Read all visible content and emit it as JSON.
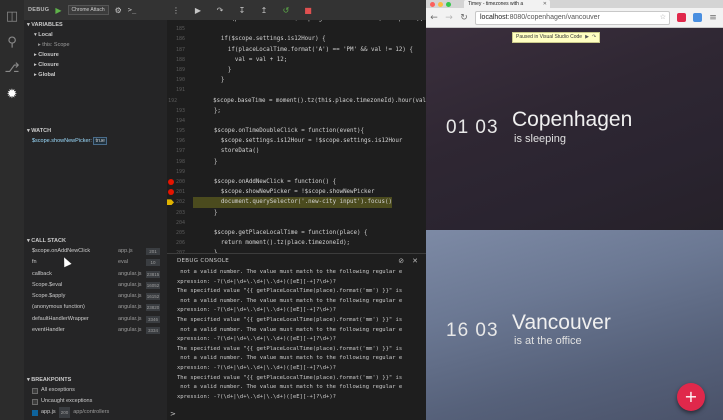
{
  "activity_bar": {
    "icons": [
      "files-icon",
      "search-icon",
      "git-icon",
      "debug-icon"
    ]
  },
  "debug_panel": {
    "label": "DEBUG",
    "config": "Chrome Attach",
    "variables": {
      "header": "VARIABLES",
      "scopes": [
        {
          "label": "Local",
          "level": 1
        },
        {
          "label": "this: Scope",
          "level": 2
        },
        {
          "label": "Closure",
          "level": 1
        },
        {
          "label": "Closure",
          "level": 1
        },
        {
          "label": "Global",
          "level": 1
        }
      ]
    },
    "watch": {
      "header": "WATCH",
      "expr": "$scope.showNewPicker:",
      "value": "true"
    },
    "call_stack": {
      "header": "CALL STACK",
      "frames": [
        {
          "fn": "$scope.onAddNewClick",
          "file": "app.js",
          "loc": "201"
        },
        {
          "fn": "fn",
          "file": "eval",
          "loc": "10"
        },
        {
          "fn": "callback",
          "file": "angular.js",
          "loc": "23815"
        },
        {
          "fn": "Scope.$eval",
          "file": "angular.js",
          "loc": "16052"
        },
        {
          "fn": "Scope.$apply",
          "file": "angular.js",
          "loc": "16152"
        },
        {
          "fn": "(anonymous function)",
          "file": "angular.js",
          "loc": "23820"
        },
        {
          "fn": "defaultHandlerWrapper",
          "file": "angular.js",
          "loc": "3346"
        },
        {
          "fn": "eventHandler",
          "file": "angular.js",
          "loc": "3334"
        }
      ]
    },
    "breakpoints": {
      "header": "BREAKPOINTS",
      "items": [
        {
          "label": "All exceptions",
          "checked": false
        },
        {
          "label": "Uncaught exceptions",
          "checked": false
        },
        {
          "label": "app.js",
          "loc": "200",
          "path": "app/controllers",
          "checked": true
        }
      ]
    }
  },
  "editor": {
    "lines": [
      {
        "n": "",
        "t": "        if (placeLocalTime = $scope.getPlaceLocalTime(this.place);"
      },
      {
        "n": "185",
        "t": ""
      },
      {
        "n": "186",
        "t": "        if($scope.settings.is12Hour) {"
      },
      {
        "n": "187",
        "t": "          if(placeLocalTime.format('A') == 'PM' && val != 12) {"
      },
      {
        "n": "188",
        "t": "            val = val + 12;"
      },
      {
        "n": "189",
        "t": "          }"
      },
      {
        "n": "190",
        "t": "        }"
      },
      {
        "n": "191",
        "t": ""
      },
      {
        "n": "192",
        "t": "        $scope.baseTime = moment().tz(this.place.timezoneId).hour(val"
      },
      {
        "n": "193",
        "t": "      };"
      },
      {
        "n": "194",
        "t": ""
      },
      {
        "n": "195",
        "t": "      $scope.onTimeDoubleClick = function(event){"
      },
      {
        "n": "196",
        "t": "        $scope.settings.is12Hour = !$scope.settings.is12Hour"
      },
      {
        "n": "197",
        "t": "        storeData()"
      },
      {
        "n": "198",
        "t": "      }"
      },
      {
        "n": "199",
        "t": ""
      },
      {
        "n": "200",
        "t": "      $scope.onAddNewClick = function() {",
        "bp": true
      },
      {
        "n": "201",
        "t": "        $scope.showNewPicker = !$scope.showNewPicker",
        "bp": true
      },
      {
        "n": "202",
        "t": "        document.querySelector('.new-city input').focus()",
        "cur": true
      },
      {
        "n": "203",
        "t": "      }"
      },
      {
        "n": "204",
        "t": ""
      },
      {
        "n": "205",
        "t": "      $scope.getPlaceLocalTime = function(place) {"
      },
      {
        "n": "206",
        "t": "        return moment().tz(place.timezoneId);"
      },
      {
        "n": "207",
        "t": "      }"
      },
      {
        "n": "208",
        "t": ""
      },
      {
        "n": "209",
        "t": "      $scope.onBodyKeyDown = function(e) {"
      }
    ]
  },
  "console": {
    "title": "DEBUG CONSOLE",
    "lines": [
      " not a valid number. The value must match to the following regular e",
      "xpression: -?(\\d+|\\d+\\.\\d+|\\.\\d+)([eE][-+]?\\d+)?",
      "The specified value \"{{ getPlaceLocalTime(place).format('mm') }}\" is",
      " not a valid number. The value must match to the following regular e",
      "xpression: -?(\\d+|\\d+\\.\\d+|\\.\\d+)([eE][-+]?\\d+)?",
      "The specified value \"{{ getPlaceLocalTime(place).format('mm') }}\" is",
      " not a valid number. The value must match to the following regular e",
      "xpression: -?(\\d+|\\d+\\.\\d+|\\.\\d+)([eE][-+]?\\d+)?",
      "The specified value \"{{ getPlaceLocalTime(place).format('mm') }}\" is",
      " not a valid number. The value must match to the following regular e",
      "xpression: -?(\\d+|\\d+\\.\\d+|\\.\\d+)([eE][-+]?\\d+)?",
      "The specified value \"{{ getPlaceLocalTime(place).format('mm') }}\" is",
      " not a valid number. The value must match to the following regular e",
      "xpression: -?(\\d+|\\d+\\.\\d+|\\.\\d+)([eE][-+]?\\d+)?"
    ],
    "prompt": ">"
  },
  "browser": {
    "tab_title": "Timey - timezones with a",
    "url_host": "localhost",
    "url_path": ":8080/copenhagen/vancouver",
    "paused_banner": "Paused in Visual Studio Code"
  },
  "app": {
    "cities": [
      {
        "time": "01 03",
        "name": "Copenhagen",
        "status": "is sleeping"
      },
      {
        "time": "16 03",
        "name": "Vancouver",
        "status": "is at the office"
      }
    ],
    "fab_label": "+"
  }
}
